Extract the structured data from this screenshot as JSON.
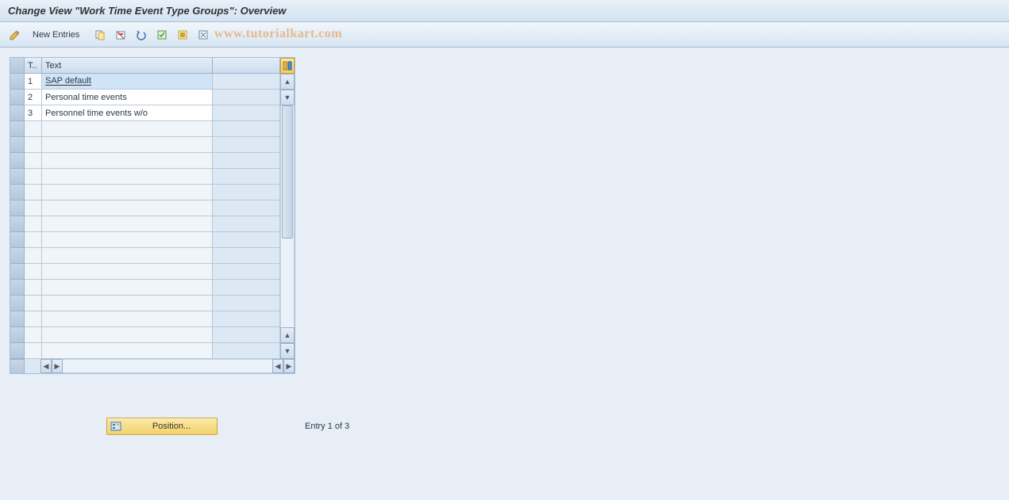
{
  "title": "Change View \"Work Time Event Type Groups\": Overview",
  "toolbar": {
    "new_entries_label": "New Entries"
  },
  "watermark": "www.tutorialkart.com",
  "table": {
    "columns": {
      "t": "T..",
      "text": "Text"
    },
    "rows": [
      {
        "t": "1",
        "text": "SAP default",
        "selected": true
      },
      {
        "t": "2",
        "text": "Personal time events",
        "selected": false
      },
      {
        "t": "3",
        "text": "Personnel time events w/o",
        "selected": false
      }
    ],
    "empty_row_count": 15
  },
  "footer": {
    "position_label": "Position...",
    "entry_status": "Entry 1 of 3"
  }
}
